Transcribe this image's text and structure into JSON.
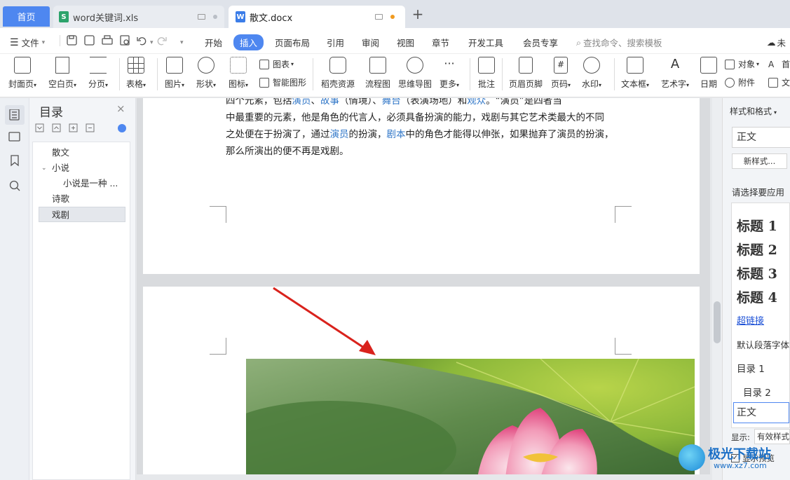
{
  "tabs": {
    "home": "首页",
    "xls": "word关键词.xls",
    "doc": "散文.docx",
    "add": "+"
  },
  "menu": {
    "file": "文件",
    "items": [
      "开始",
      "插入",
      "页面布局",
      "引用",
      "审阅",
      "视图",
      "章节",
      "开发工具",
      "会员专享"
    ],
    "search": "查找命令、搜索模板",
    "cloud": "未"
  },
  "ribbon": {
    "cover": "封面页",
    "blank": "空白页",
    "pagebreak": "分页",
    "table": "表格",
    "picture": "图片",
    "shape": "形状",
    "icon": "图标",
    "chart": "图表",
    "smartart": "智能图形",
    "docer": "稻壳资源",
    "flowchart": "流程图",
    "mindmap": "思维导图",
    "more": "更多",
    "comment": "批注",
    "headerfooter": "页眉页脚",
    "pagenum": "页码",
    "watermark": "水印",
    "textbox": "文本框",
    "wordart": "艺术字",
    "date": "日期",
    "object": "对象",
    "attachment": "附件",
    "first": "首",
    "text": "文"
  },
  "nav": {
    "title": "目录",
    "items": [
      "散文",
      "小说",
      "小说是一种 ...",
      "诗歌",
      "戏剧"
    ]
  },
  "doc": {
    "line0_a": "四个元素，包括",
    "line0_link1": "演员",
    "line0_b": "、",
    "line0_link2": "故事",
    "line0_c": "（情境）、",
    "line0_link3": "舞台",
    "line0_d": "（表演场地）和",
    "line0_link4": "观众",
    "line0_e": "。“演员”是四者当",
    "line1": "中最重要的元素，他是角色的代言人，必须具备扮演的能力，戏剧与其它艺术类最大的不同",
    "line2_a": "之处便在于扮演了，通过",
    "line2_link1": "演员",
    "line2_b": "的扮演，",
    "line2_link2": "剧本",
    "line2_c": "中的角色才能得以伸张，如果抛弃了演员的扮演，",
    "line3": "那么所演出的便不再是戏剧。"
  },
  "rightpanel": {
    "header": "样式和格式",
    "current_style": "正文",
    "new_style": "新样式...",
    "choose": "请选择要应用",
    "styles": [
      "标题  1",
      "标题  2",
      "标题  3",
      "标题  4",
      "超链接",
      "默认段落字体",
      "目录  1",
      "目录  2",
      "正文"
    ],
    "show_label": "显示:",
    "show_value": "有效样式",
    "preview_label": "显示预览"
  },
  "watermark_text": {
    "brand": "极光下载站",
    "url": "www.xz7.com"
  },
  "colors": {
    "accent": "#4e87f0",
    "link": "#2e75c7",
    "arrow": "#d9221c"
  }
}
